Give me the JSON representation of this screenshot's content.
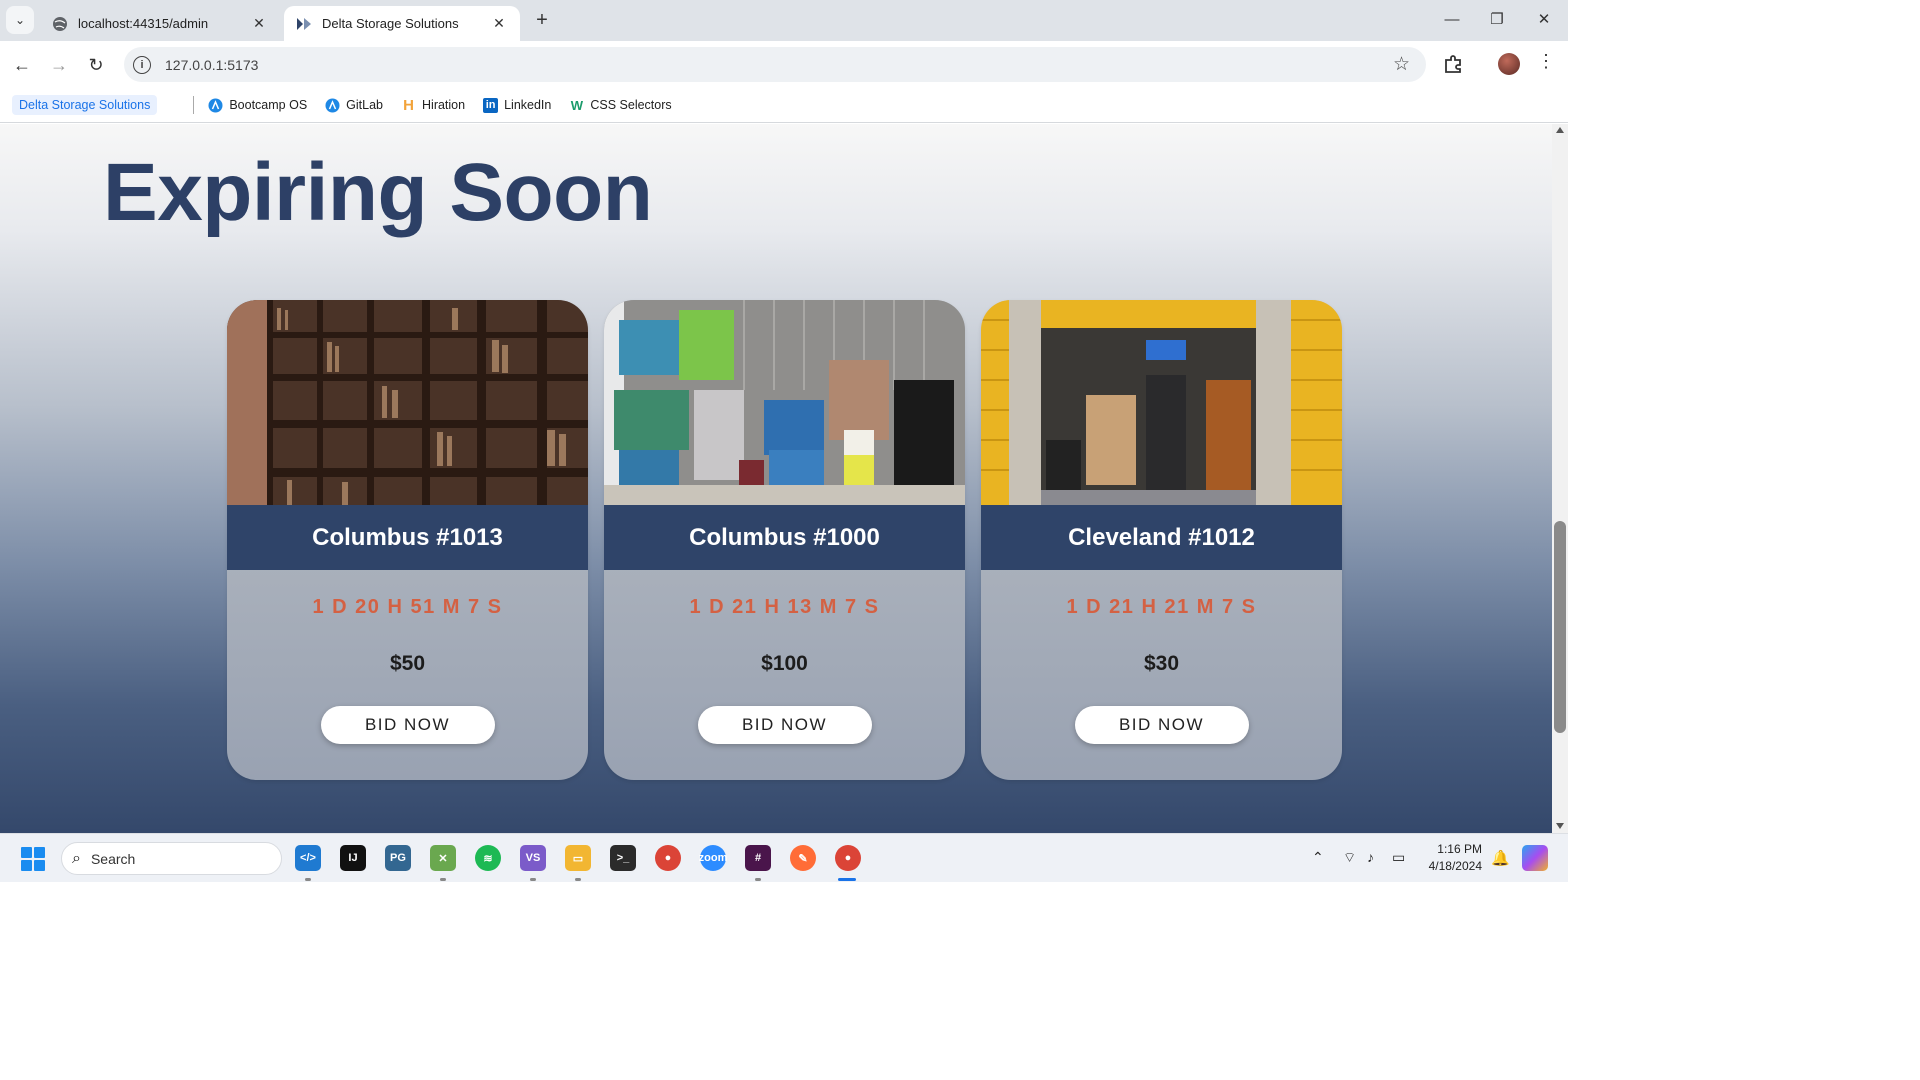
{
  "browser": {
    "tabs": [
      {
        "title": "localhost:44315/admin",
        "active": false
      },
      {
        "title": "Delta Storage Solutions",
        "active": true
      }
    ],
    "url": "127.0.0.1:5173",
    "bookmarks": [
      {
        "label": "Delta Storage Solutions",
        "icon": "site-icon"
      },
      {
        "label": "Bootcamp OS",
        "icon": "bootcamp-icon"
      },
      {
        "label": "GitLab",
        "icon": "gitlab-icon"
      },
      {
        "label": "Hiration",
        "icon": "hiration-icon"
      },
      {
        "label": "LinkedIn",
        "icon": "linkedin-icon"
      },
      {
        "label": "CSS Selectors",
        "icon": "css-icon"
      }
    ]
  },
  "page": {
    "heading": "Expiring Soon",
    "cards": [
      {
        "name": "Columbus #1013",
        "timer": "1 D 20 H 51 M 7 S",
        "price": "$50",
        "button": "BID NOW",
        "image": "bookshelf-photo"
      },
      {
        "name": "Columbus #1000",
        "timer": "1 D 21 H 13 M 7 S",
        "price": "$100",
        "button": "BID NOW",
        "image": "storage-bins-photo"
      },
      {
        "name": "Cleveland #1012",
        "timer": "1 D 21 H 21 M 7 S",
        "price": "$30",
        "button": "BID NOW",
        "image": "storage-unit-photo"
      }
    ],
    "colors": {
      "heading": "#2d4066",
      "name_bar": "#2f4469",
      "timer": "#d46143"
    }
  },
  "taskbar": {
    "search_placeholder": "Search",
    "time": "1:16 PM",
    "date": "4/18/2024"
  }
}
